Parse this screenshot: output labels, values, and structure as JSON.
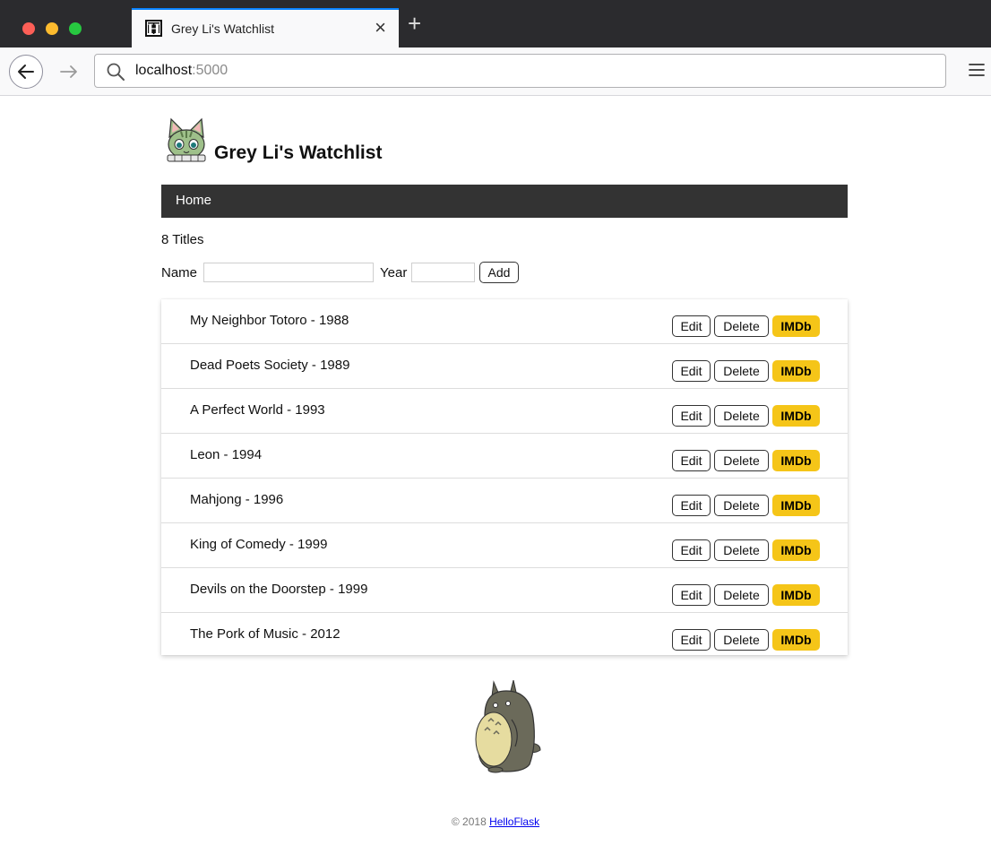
{
  "browser": {
    "tab_title": "Grey Li's Watchlist",
    "favicon_letter": "H",
    "tab_close": "×",
    "new_tab": "+",
    "url_host": "localhost",
    "url_port": ":5000"
  },
  "header": {
    "title": "Grey Li's Watchlist"
  },
  "nav": {
    "home": "Home"
  },
  "count_text": "8 Titles",
  "form": {
    "name_label": "Name",
    "name_value": "",
    "year_label": "Year",
    "year_value": "",
    "add_label": "Add"
  },
  "actions": {
    "edit": "Edit",
    "delete": "Delete",
    "imdb": "IMDb"
  },
  "movies": [
    {
      "title": "My Neighbor Totoro - 1988"
    },
    {
      "title": "Dead Poets Society - 1989"
    },
    {
      "title": "A Perfect World - 1993"
    },
    {
      "title": "Leon - 1994"
    },
    {
      "title": "Mahjong - 1996"
    },
    {
      "title": "King of Comedy - 1999"
    },
    {
      "title": "Devils on the Doorstep - 1999"
    },
    {
      "title": "The Pork of Music - 2012"
    }
  ],
  "footer": {
    "copyright": "© 2018 ",
    "link_text": "HelloFlask"
  },
  "colors": {
    "nav_bg": "#333333",
    "imdb": "#f5c518",
    "accent": "#0a84ff"
  }
}
